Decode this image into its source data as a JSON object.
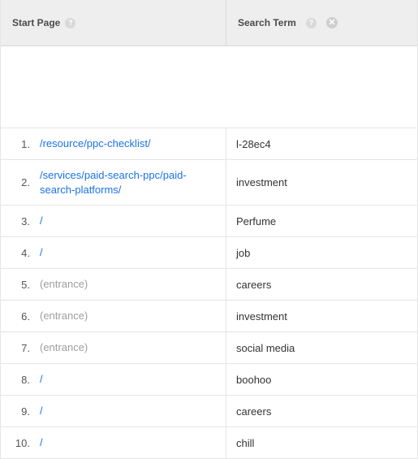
{
  "header": {
    "start_page_label": "Start Page",
    "search_term_label": "Search Term"
  },
  "rows": [
    {
      "index": "1.",
      "start_page": "/resource/ppc-checklist/",
      "style": "link",
      "search_term": "l-28ec4"
    },
    {
      "index": "2.",
      "start_page": "/services/paid-search-ppc/paid-search-platforms/",
      "style": "link",
      "search_term": "investment"
    },
    {
      "index": "3.",
      "start_page": "/",
      "style": "link",
      "search_term": "Perfume"
    },
    {
      "index": "4.",
      "start_page": "/",
      "style": "link",
      "search_term": "job"
    },
    {
      "index": "5.",
      "start_page": "(entrance)",
      "style": "gray",
      "search_term": "careers"
    },
    {
      "index": "6.",
      "start_page": "(entrance)",
      "style": "gray",
      "search_term": "investment"
    },
    {
      "index": "7.",
      "start_page": "(entrance)",
      "style": "gray",
      "search_term": "social media"
    },
    {
      "index": "8.",
      "start_page": "/",
      "style": "link",
      "search_term": "boohoo"
    },
    {
      "index": "9.",
      "start_page": "/",
      "style": "link",
      "search_term": "careers"
    },
    {
      "index": "10.",
      "start_page": "/",
      "style": "link",
      "search_term": "chill"
    }
  ]
}
